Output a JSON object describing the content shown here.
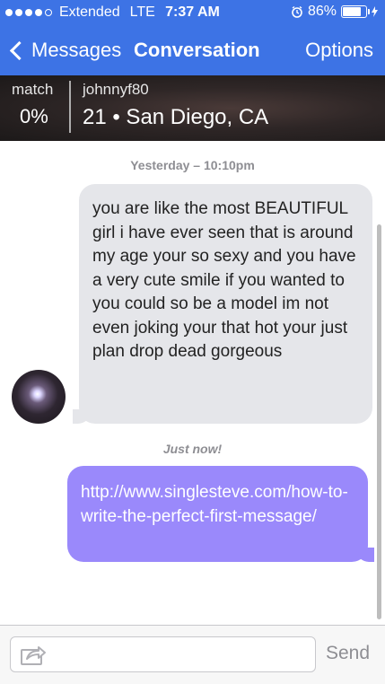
{
  "status_bar": {
    "carrier": "Extended",
    "network": "LTE",
    "time": "7:37 AM",
    "battery": "86%",
    "battery_level": 0.86
  },
  "nav": {
    "back_label": "Messages",
    "title": "Conversation",
    "options_label": "Options"
  },
  "profile": {
    "match_label": "match",
    "match_value": "0%",
    "username": "johnnyf80",
    "age_location": "21 • San Diego, CA"
  },
  "conversation": {
    "timestamp_1": "Yesterday – 10:10pm",
    "incoming_message": "you are like the most BEAUTIFUL girl i have ever seen that is around my age your so sexy and you have a very cute smile if you wanted to you could so be a model im not even joking your that hot your just plan drop dead gorgeous",
    "timestamp_2": "Just now!",
    "outgoing_message": "http://www.singlesteve.com/how-to-write-the-perfect-first-message/"
  },
  "composer": {
    "input_value": "",
    "send_label": "Send"
  },
  "colors": {
    "nav_bar": "#3d73e5",
    "incoming_bubble": "#e5e6ea",
    "outgoing_bubble": "#9a89fb"
  }
}
